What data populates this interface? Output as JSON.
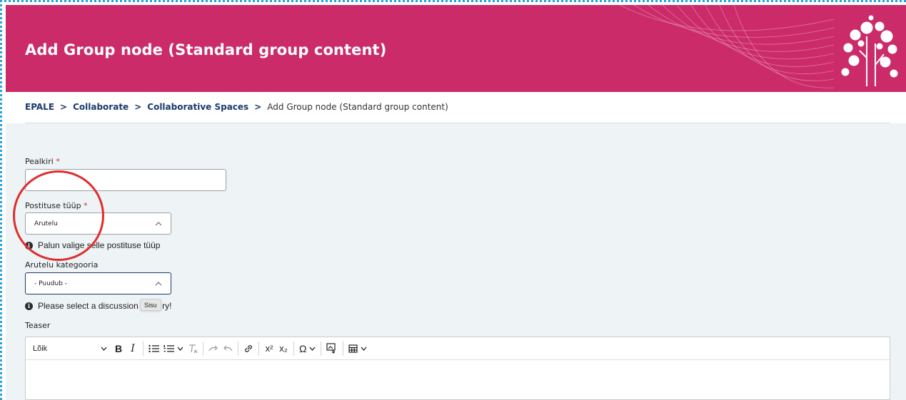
{
  "header": {
    "title": "Add Group node (Standard group content)",
    "color": "#cc2b6a"
  },
  "breadcrumb": {
    "items": [
      "EPALE",
      "Collaborate",
      "Collaborative Spaces"
    ],
    "current": "Add Group node (Standard group content)",
    "separator": ">"
  },
  "form": {
    "title_label": "Pealkiri",
    "title_value": "",
    "required_mark": "*",
    "post_type_label": "Postituse tüüp",
    "post_type_value": "Arutelu",
    "post_type_help": "Palun valige selle postituse tüüp",
    "category_label": "Arutelu kategooria",
    "category_value": "- Puudub -",
    "category_help_start": "Please select a discussion c",
    "category_help_end": "ry!",
    "tooltip": "Sisu",
    "teaser_label": "Teaser"
  },
  "editor": {
    "format_label": "Lõik",
    "bold_label": "B",
    "italic_label": "I",
    "special_chars_label": "Ω",
    "superscript_label": "x²",
    "subscript_label": "x₂"
  },
  "icons": {
    "info": "info-icon",
    "chevron": "chevron-up-icon"
  },
  "colors": {
    "accent": "#cc2b6a",
    "link": "#1a3a6b",
    "required": "#d32f2f",
    "highlight_circle": "#e02c2c"
  }
}
